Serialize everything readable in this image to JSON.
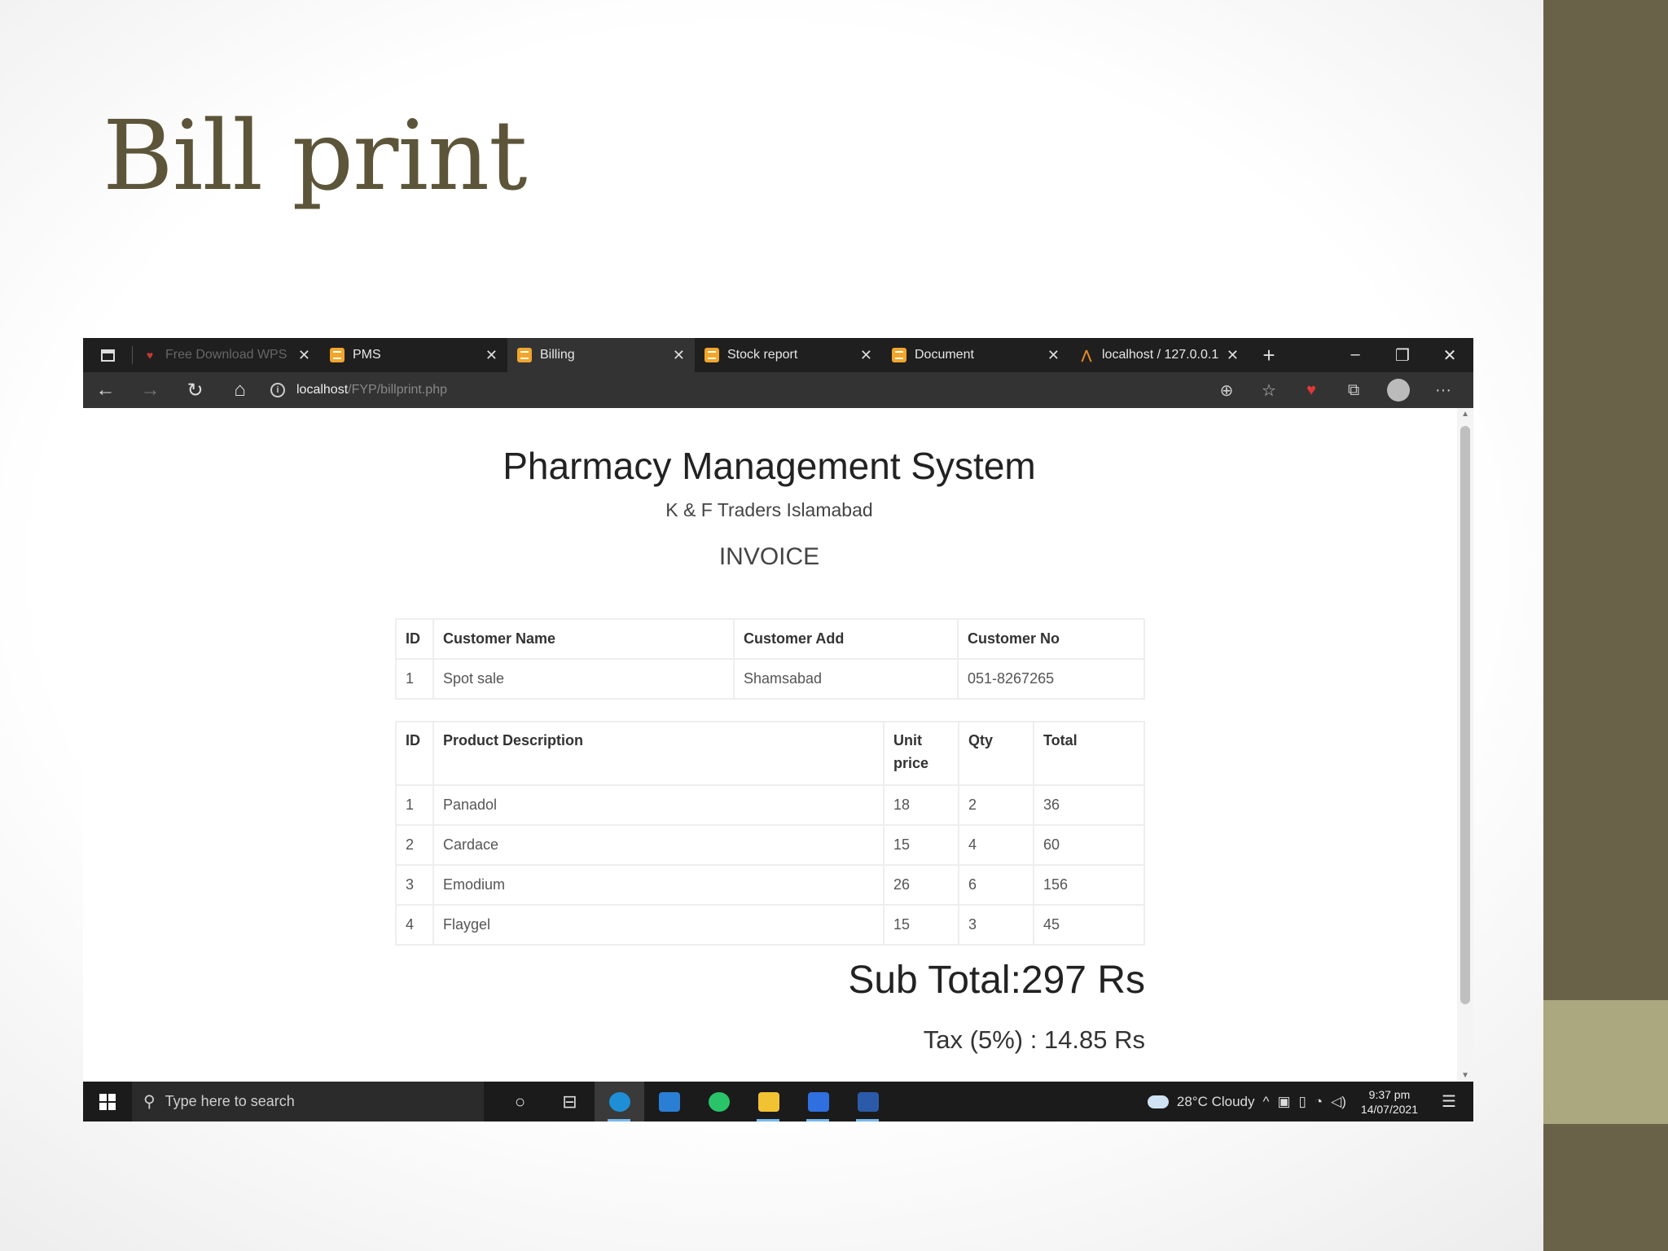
{
  "slide": {
    "title": "Bill print"
  },
  "browser": {
    "tabs": [
      {
        "label": "Free Download WPS ",
        "icon": "wps-icon"
      },
      {
        "label": "PMS",
        "icon": "xampp-icon"
      },
      {
        "label": "Billing",
        "icon": "xampp-icon",
        "active": true
      },
      {
        "label": "Stock report",
        "icon": "xampp-icon"
      },
      {
        "label": "Document",
        "icon": "xampp-icon"
      },
      {
        "label": "localhost / 127.0.0.1 / ",
        "icon": "phpmyadmin-icon"
      }
    ],
    "url_host": "localhost",
    "url_path": "/FYP/billprint.php"
  },
  "invoice": {
    "company": "Pharmacy Management System",
    "subtitle": "K & F Traders Islamabad",
    "heading": "INVOICE",
    "customer_headers": [
      "ID",
      "Customer Name",
      "Customer Add",
      "Customer No"
    ],
    "customer_row": [
      "1",
      "Spot sale",
      "Shamsabad",
      "051-8267265"
    ],
    "product_headers": [
      "ID",
      "Product Description",
      "Unit price",
      "Qty",
      "Total"
    ],
    "products": [
      [
        "1",
        "Panadol",
        "18",
        "2",
        "36"
      ],
      [
        "2",
        "Cardace",
        "15",
        "4",
        "60"
      ],
      [
        "3",
        "Emodium",
        "26",
        "6",
        "156"
      ],
      [
        "4",
        "Flaygel",
        "15",
        "3",
        "45"
      ]
    ],
    "sub_total": "Sub Total:297 Rs",
    "tax": "Tax (5%) : 14.85 Rs"
  },
  "taskbar": {
    "search_placeholder": "Type here to search",
    "weather": "28°C  Cloudy",
    "time": "9:37 pm",
    "date": "14/07/2021"
  },
  "colors": {
    "slide_accent": "#6a6248",
    "slide_accent_light": "#aba77f",
    "title": "#5c5539"
  }
}
